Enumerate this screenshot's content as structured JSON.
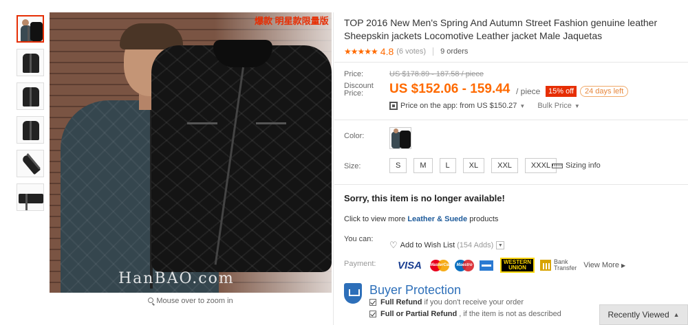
{
  "gallery": {
    "thumbnail_count": 6,
    "watermark": "HanBAO.com",
    "promo_tag": "爆款 明星款限量版",
    "zoom_hint": "Mouse over to zoom in"
  },
  "product": {
    "title": "TOP 2016 New Men's Spring And Autumn Street Fashion genuine leather Sheepskin jackets Locomotive Leather jacket Male Jaquetas",
    "stars": "★★★★★",
    "rating": "4.8",
    "votes": "(6 votes)",
    "orders": "9 orders"
  },
  "price": {
    "label": "Price:",
    "original": "US $178.89 - 187.58 / piece",
    "discount_label": "Discount Price:",
    "current": "US $152.06 - 159.44",
    "unit": "/ piece",
    "off_badge": "15% off",
    "days_left": "24 days left",
    "app_price": "Price on the app: from US $150.27",
    "bulk_price": "Bulk Price",
    "accent_color": "#ff6a00"
  },
  "options": {
    "color_label": "Color:",
    "size_label": "Size:",
    "sizes": [
      "S",
      "M",
      "L",
      "XL",
      "XXL",
      "XXXL"
    ],
    "sizing_info": "Sizing info"
  },
  "availability": {
    "message": "Sorry, this item is no longer available!",
    "view_more_prefix": "Click to view more",
    "category_link": "Leather & Suede",
    "view_more_suffix": "products"
  },
  "actions": {
    "you_can_label": "You can:",
    "wish_list": "Add to Wish List",
    "wish_count": "(154 Adds)"
  },
  "payment": {
    "label": "Payment:",
    "visa": "VISA",
    "mastercard": "MasterCard",
    "maestro": "Maestro",
    "western_union_top": "WESTERN",
    "western_union_bottom": "UNION",
    "bank_line1": "Bank",
    "bank_line2": "Transfer",
    "view_more": "View More"
  },
  "buyer_protection": {
    "title": "Buyer Protection",
    "line1_bold": "Full Refund",
    "line1_text": "if you don't receive your order",
    "line2_bold": "Full or Partial Refund",
    "line2_text": ", if the item is not as described",
    "color": "#2d6fb9"
  },
  "footer": {
    "recently_viewed": "Recently Viewed"
  }
}
